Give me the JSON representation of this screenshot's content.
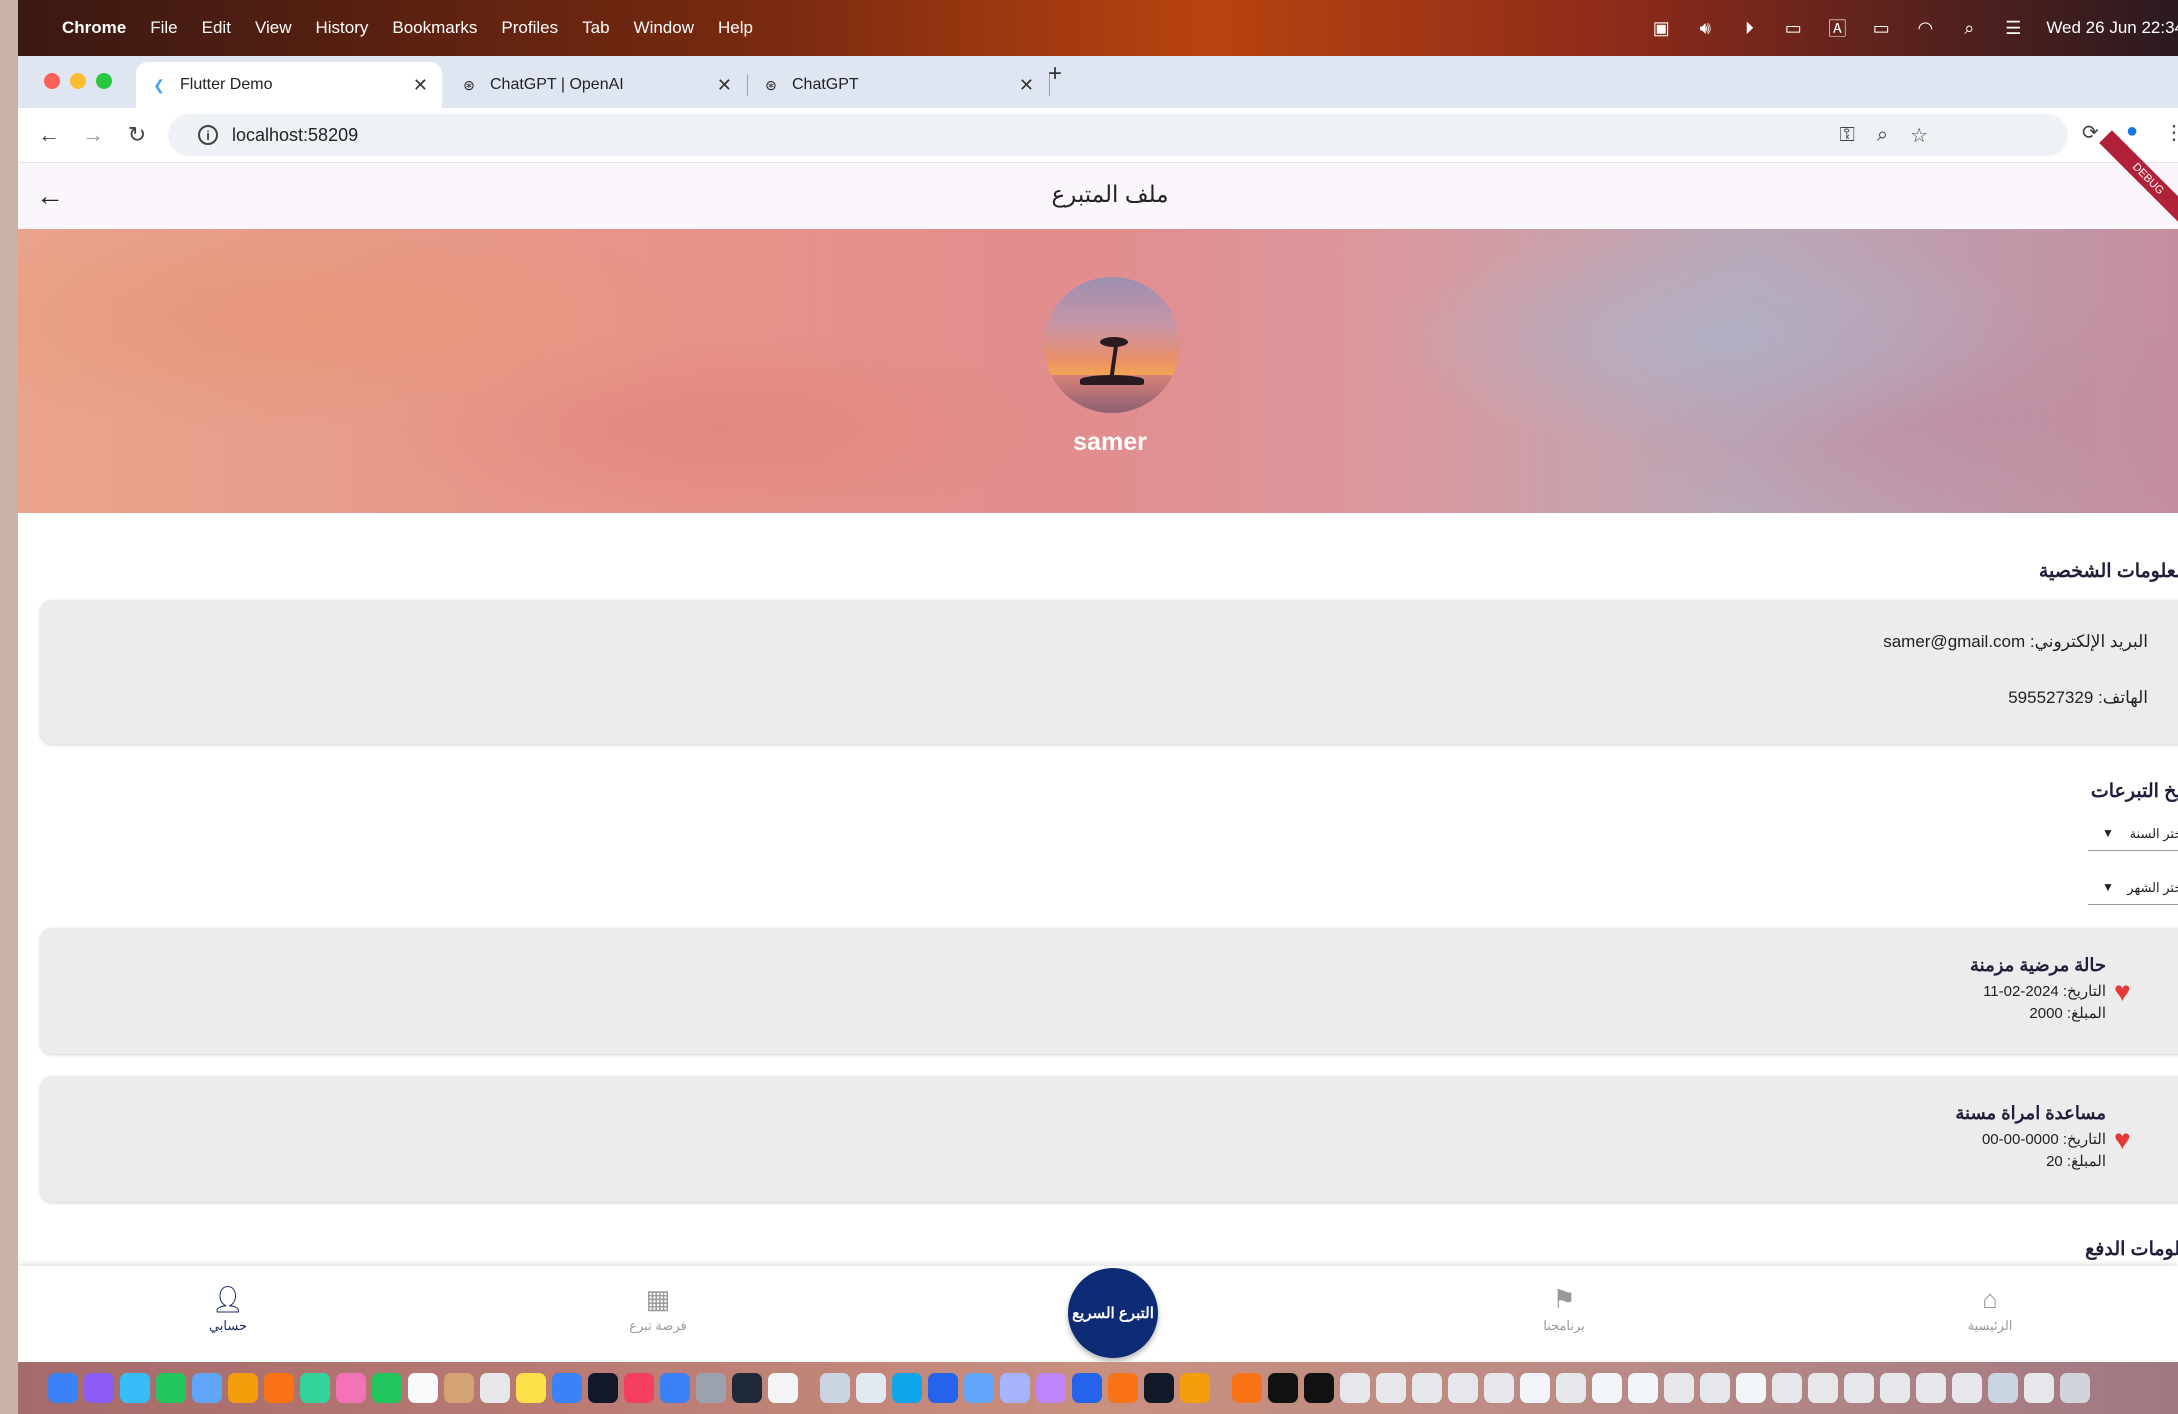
{
  "menubar": {
    "app": "Chrome",
    "items": [
      "File",
      "Edit",
      "View",
      "History",
      "Bookmarks",
      "Profiles",
      "Tab",
      "Window",
      "Help"
    ],
    "clock": "Wed 26 Jun 22:34"
  },
  "tabs": [
    {
      "title": "Flutter Demo",
      "icon": "flutter-icon"
    },
    {
      "title": "ChatGPT | OpenAI",
      "icon": "openai-icon"
    },
    {
      "title": "ChatGPT",
      "icon": "openai-icon"
    }
  ],
  "address": {
    "url": "localhost:58209"
  },
  "appbar": {
    "title": "ملف المتبرع"
  },
  "debug_banner": "DEBUG",
  "profile": {
    "name": "samer"
  },
  "personal": {
    "title": "المعلومات الشخصية",
    "email": "البريد الإلكتروني: samer@gmail.com",
    "phone": "الهاتف: 595527329"
  },
  "history": {
    "title": "تاريخ التبرعات",
    "year_dropdown": "اختر السنة",
    "month_dropdown": "اختر الشهر",
    "donations": [
      {
        "title": "حالة مرضية مزمنة",
        "date": "التاريخ: 2024-02-11",
        "amount": "المبلغ: 2000"
      },
      {
        "title": "مساعدة امراة مسنة",
        "date": "التاريخ: 0000-00-00",
        "amount": "المبلغ: 20"
      }
    ]
  },
  "payment": {
    "title": "معلومات الدفع"
  },
  "bottom_nav": {
    "account": "حسابي",
    "opportunity": "فرصة تبرع",
    "programs": "برنامجنا",
    "home": "الرئيسية",
    "quick_donate": "التبرع السريع"
  },
  "colors": {
    "primary": "#0d2a74",
    "heart": "#e53935",
    "card": "#ececec"
  }
}
